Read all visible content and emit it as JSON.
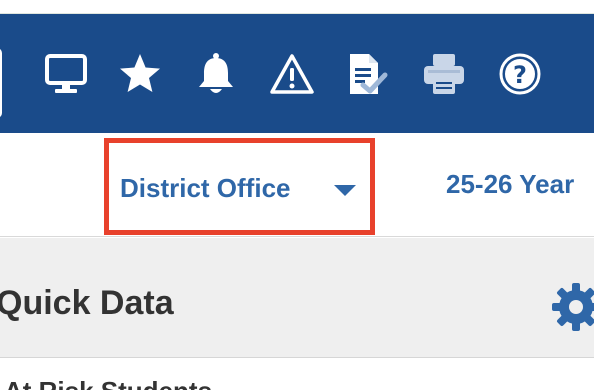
{
  "toolbar": {
    "bg_color": "#1a4b8a",
    "icons": [
      {
        "name": "monitor-icon"
      },
      {
        "name": "star-icon"
      },
      {
        "name": "bell-icon"
      },
      {
        "name": "warning-icon"
      },
      {
        "name": "document-check-icon"
      },
      {
        "name": "printer-icon"
      },
      {
        "name": "help-icon"
      }
    ]
  },
  "selector": {
    "district_label": "District Office",
    "year_label": "25-26 Year",
    "highlight_color": "#e8412c",
    "text_color": "#2f67a8"
  },
  "quick_data": {
    "title": "Quick Data"
  },
  "list": {
    "first_item": "At Risk Students"
  }
}
